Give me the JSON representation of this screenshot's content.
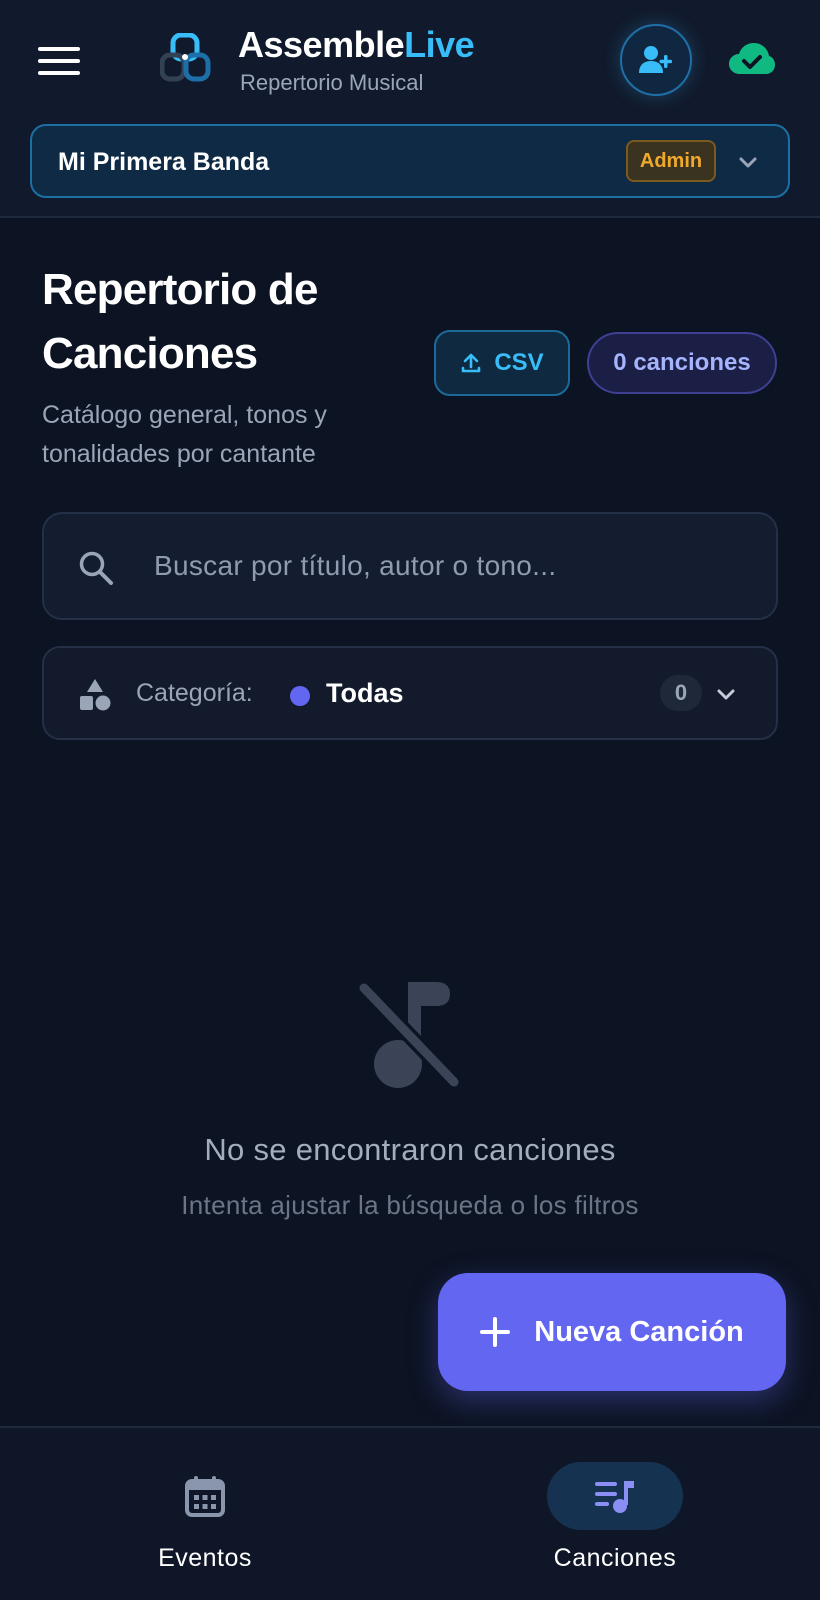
{
  "header": {
    "app_name_part1": "Assemble",
    "app_name_part2": "Live",
    "app_subtitle": "Repertorio Musical",
    "icons": [
      "menu-icon",
      "logo-icon",
      "user-plus-icon",
      "cloud-check-icon"
    ],
    "colors": {
      "accent": "#38bdf8",
      "sync_ok": "#10b981"
    }
  },
  "band_selector": {
    "name": "Mi Primera Banda",
    "role": "Admin",
    "role_color": "#f0a92c"
  },
  "page": {
    "title": "Repertorio de Canciones",
    "description": "Catálogo general, tonos y tonalidades por cantante",
    "csv_label": "CSV",
    "count_label": "0 canciones"
  },
  "search": {
    "value": "",
    "placeholder": "Buscar por título, autor o tono..."
  },
  "category_filter": {
    "label": "Categoría:",
    "value": "Todas",
    "count": "0",
    "dot_color": "#6366f1"
  },
  "empty_state": {
    "title": "No se encontraron canciones",
    "subtitle": "Intenta ajustar la búsqueda o los filtros",
    "icon": "music-off-icon"
  },
  "fab": {
    "label": "Nueva Canción",
    "color": "#6366f1"
  },
  "bottom_nav": {
    "items": [
      {
        "label": "Eventos",
        "icon": "calendar-icon",
        "active": false
      },
      {
        "label": "Canciones",
        "icon": "playlist-music-icon",
        "active": true
      }
    ]
  }
}
